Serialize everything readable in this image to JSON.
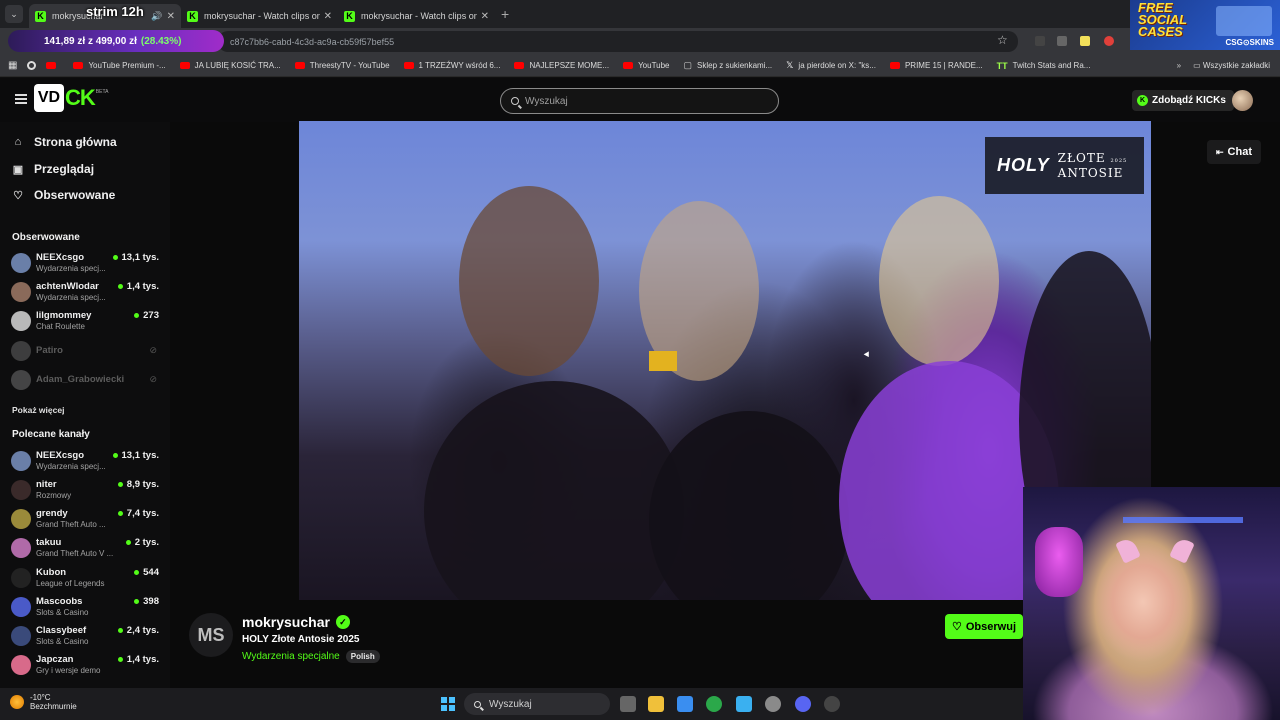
{
  "browser": {
    "tabs": [
      {
        "title": "mokrysuchar",
        "overlay": "strim 12h",
        "active": true
      },
      {
        "title": "mokrysuchar - Watch clips on K",
        "active": false
      },
      {
        "title": "mokrysuchar - Watch clips on K",
        "active": false
      }
    ],
    "stock_ticker": {
      "value": "141,89 zł",
      "separator": "z",
      "total": "499,00 zł",
      "change": "(28.43%)"
    },
    "url": "c87c7bb6-cabd-4c3d-ac9a-cb59f57bef55",
    "bookmarks": [
      {
        "label": "",
        "icon": "grid-icon"
      },
      {
        "label": "",
        "icon": "chrome-icon"
      },
      {
        "label": "",
        "icon": "youtube-icon"
      },
      {
        "label": "YouTube Premium -...",
        "icon": "youtube-icon"
      },
      {
        "label": "JA LUBIĘ KOSIĆ TRA...",
        "icon": "youtube-icon"
      },
      {
        "label": "ThreestyTV - YouTube",
        "icon": "youtube-icon"
      },
      {
        "label": "1 TRZEŹWY wśród 6...",
        "icon": "youtube-icon"
      },
      {
        "label": "NAJLEPSZE MOME...",
        "icon": "youtube-icon"
      },
      {
        "label": "YouTube",
        "icon": "youtube-icon"
      },
      {
        "label": "Sklep z sukienkami...",
        "icon": "shop-icon"
      },
      {
        "label": "ja pierdole on X: \"ks...",
        "icon": "x-icon"
      },
      {
        "label": "PRIME 15 | RANDE...",
        "icon": "youtube-icon"
      },
      {
        "label": "Twitch Stats and Ra...",
        "icon": "twitch-tracker-icon"
      }
    ],
    "all_bookmarks": "Wszystkie zakładki"
  },
  "ad": {
    "line1": "FREE",
    "line2": "SOCIAL",
    "line3": "CASES",
    "brand": "CSG⊙SKINS"
  },
  "header": {
    "logo_box": "VD",
    "logo_text": "CK",
    "logo_badge": "BETA",
    "search_placeholder": "Wyszukaj",
    "get_kicks": "Zdobądź KICKs"
  },
  "sidebar": {
    "nav": [
      {
        "label": "Strona główna",
        "icon": "home-icon"
      },
      {
        "label": "Przeglądaj",
        "icon": "browse-icon"
      },
      {
        "label": "Obserwowane",
        "icon": "heart-icon"
      }
    ],
    "followed_title": "Obserwowane",
    "followed": [
      {
        "name": "NEEXcsgo",
        "category": "Wydarzenia specj...",
        "viewers": "13,1 tys.",
        "online": true,
        "color": "#6a7fa8"
      },
      {
        "name": "achtenWlodar",
        "category": "Wydarzenia specj...",
        "viewers": "1,4 tys.",
        "online": true,
        "color": "#8a6a5a"
      },
      {
        "name": "lilgmommey",
        "category": "Chat Roulette",
        "viewers": "273",
        "online": true,
        "color": "#b9b9b9"
      },
      {
        "name": "Patiro",
        "category": "",
        "viewers": "",
        "online": false,
        "color": "#888"
      },
      {
        "name": "Adam_Grabowiecki",
        "category": "",
        "viewers": "",
        "online": false,
        "color": "#999"
      }
    ],
    "show_more": "Pokaż więcej",
    "recommended_title": "Polecane kanały",
    "recommended": [
      {
        "name": "NEEXcsgo",
        "category": "Wydarzenia specj...",
        "viewers": "13,1 tys.",
        "color": "#6a7fa8"
      },
      {
        "name": "niter",
        "category": "Rozmowy",
        "viewers": "8,9 tys.",
        "color": "#3a2a2a"
      },
      {
        "name": "grendy",
        "category": "Grand Theft Auto ...",
        "viewers": "7,4 tys.",
        "color": "#9a8a3a"
      },
      {
        "name": "takuu",
        "category": "Grand Theft Auto V ...",
        "viewers": "2 tys.",
        "color": "#b06aa8"
      },
      {
        "name": "Kubon",
        "category": "League of Legends",
        "viewers": "544",
        "color": "#222"
      },
      {
        "name": "Mascoobs",
        "category": "Slots & Casino",
        "viewers": "398",
        "color": "#4a5ac8"
      },
      {
        "name": "Classybeef",
        "category": "Slots & Casino",
        "viewers": "2,4 tys.",
        "color": "#3a4a7a"
      },
      {
        "name": "Japczan",
        "category": "Gry i wersje demo",
        "viewers": "1,4 tys.",
        "color": "#d86a8a"
      }
    ]
  },
  "player": {
    "overlay_brand": "HOLY",
    "overlay_title_1": "ZŁOTE",
    "overlay_year": "2025",
    "overlay_title_2": "ANTOSIE",
    "chat_button": "Chat"
  },
  "stream": {
    "avatar_initials": "MS",
    "streamer": "mokrysuchar",
    "title": "HOLY Złote Antosie 2025",
    "category": "Wydarzenia specjalne",
    "language": "Polish",
    "follow_button": "Obserwuj"
  },
  "taskbar": {
    "temperature": "-10°C",
    "weather_desc": "Bezchmurnie",
    "search": "Wyszukaj"
  }
}
